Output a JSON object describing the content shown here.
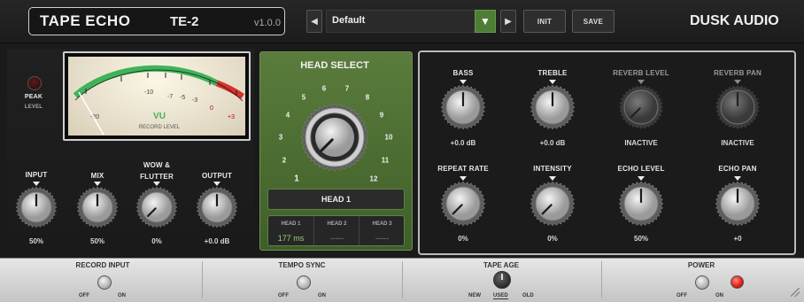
{
  "header": {
    "product_name": "TAPE ECHO",
    "model": "TE-2",
    "version": "v1.0.0",
    "preset": "Default",
    "prev_icon": "chevron-left-icon",
    "next_icon": "chevron-right-icon",
    "dropdown_icon": "triangle-down-icon",
    "init_label": "INIT",
    "save_label": "SAVE",
    "brand": "DUSK AUDIO"
  },
  "peak": {
    "label": "PEAK",
    "sublabel": "LEVEL"
  },
  "vu": {
    "label": "VU",
    "sublabel": "RECORD LEVEL",
    "scale": [
      "-20",
      "-10",
      "-7",
      "-5",
      "-3",
      "0",
      "+3"
    ],
    "needle_level": 0.0
  },
  "left_knobs": [
    {
      "label": "INPUT",
      "value": "50%"
    },
    {
      "label": "MIX",
      "value": "50%"
    },
    {
      "label": "WOW &",
      "label2": "FLUTTER",
      "value": "0%"
    },
    {
      "label": "OUTPUT",
      "value": "+0.0 dB"
    }
  ],
  "head_select": {
    "title": "HEAD SELECT",
    "numbers": [
      "1",
      "2",
      "3",
      "4",
      "5",
      "6",
      "7",
      "8",
      "9",
      "10",
      "11",
      "12"
    ],
    "current": "HEAD 1",
    "heads": [
      {
        "label": "HEAD 1",
        "value": "177 ms"
      },
      {
        "label": "HEAD 2",
        "value": "-----"
      },
      {
        "label": "HEAD 3",
        "value": "-----"
      }
    ]
  },
  "right_knobs": [
    {
      "label": "BASS",
      "value": "+0.0 dB",
      "active": true
    },
    {
      "label": "TREBLE",
      "value": "+0.0 dB",
      "active": true
    },
    {
      "label": "REVERB LEVEL",
      "value": "INACTIVE",
      "active": false
    },
    {
      "label": "REVERB PAN",
      "value": "INACTIVE",
      "active": false
    },
    {
      "label": "REPEAT RATE",
      "value": "0%",
      "active": true
    },
    {
      "label": "INTENSITY",
      "value": "0%",
      "active": true
    },
    {
      "label": "ECHO LEVEL",
      "value": "50%",
      "active": true
    },
    {
      "label": "ECHO PAN",
      "value": "+0",
      "active": true
    }
  ],
  "bottom": {
    "record_input": {
      "label": "RECORD INPUT",
      "off": "OFF",
      "on": "ON"
    },
    "tempo_sync": {
      "label": "TEMPO SYNC",
      "off": "OFF",
      "on": "ON"
    },
    "tape_age": {
      "label": "TAPE AGE",
      "new": "NEW",
      "used": "USED",
      "old": "OLD"
    },
    "power": {
      "label": "POWER",
      "off": "OFF",
      "on": "ON"
    }
  },
  "colors": {
    "accent_green": "#4e7d35",
    "meter_green": "#3fb35a",
    "meter_red": "#d8302a",
    "power_led": "#e3211c"
  }
}
